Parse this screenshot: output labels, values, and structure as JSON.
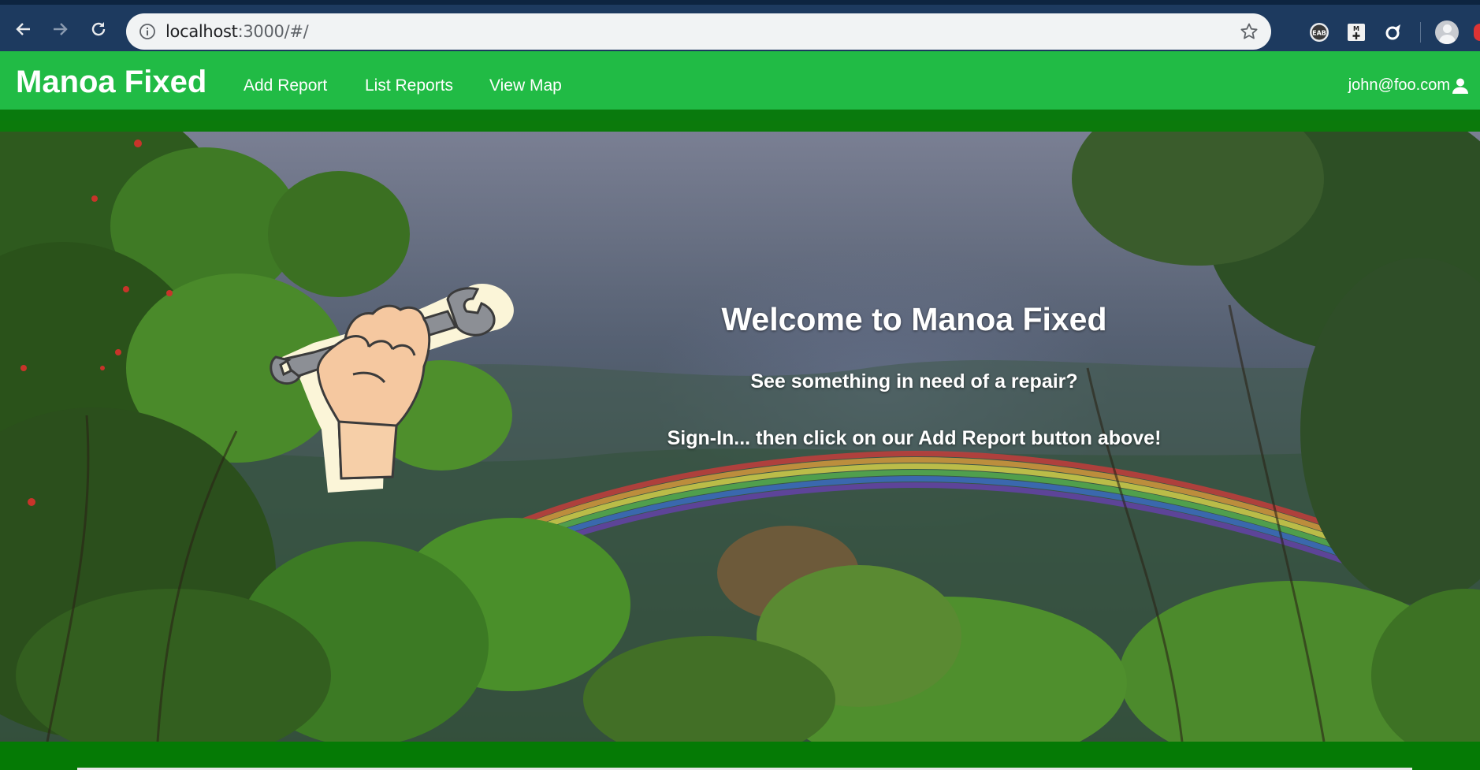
{
  "browser": {
    "url_host": "localhost",
    "url_rest": ":3000/#/",
    "icons": [
      "back-arrow-icon",
      "forward-arrow-icon",
      "reload-icon",
      "info-icon",
      "star-icon",
      "eab-extension-icon",
      "m-plus-extension-icon",
      "pinwheel-extension-icon",
      "profile-avatar-icon"
    ]
  },
  "navbar": {
    "brand": "Manoa Fixed",
    "links": [
      "Add Report",
      "List Reports",
      "View Map"
    ],
    "user": "john@foo.com",
    "user_icon": "user-icon"
  },
  "hero": {
    "title": "Welcome to Manoa Fixed",
    "line1": "See something in need of a repair?",
    "line2": "Sign-In... then click on our Add Report button above!",
    "logo_icon": "fist-holding-wrench-icon"
  },
  "colors": {
    "navbar": "#21bb45",
    "navbar_border": "#097a0d",
    "footer": "#057a05",
    "chrome": "#1d3a5f"
  }
}
